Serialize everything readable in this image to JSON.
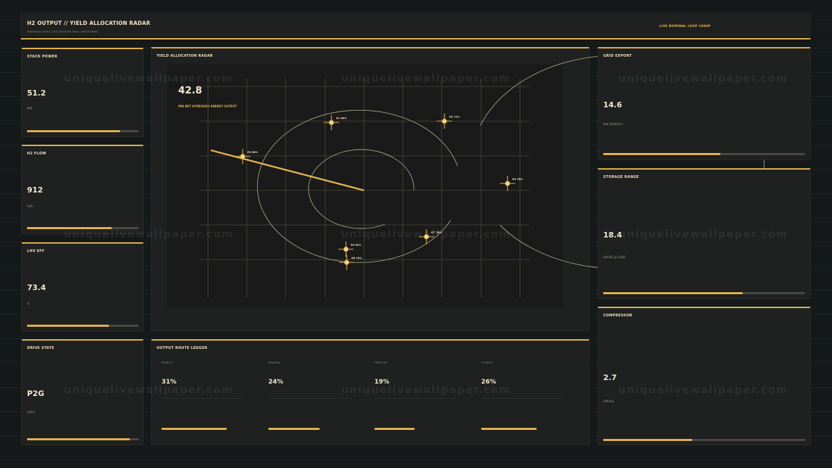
{
  "header": {
    "title": "H2 OUTPUT // YIELD ALLOCATION RADAR",
    "subtitle": "RENEWABLE INPUT / ELECTROLYZER YIELD / PARTITIONING",
    "status": "LIVE  NOMINAL  LOOP 1000P"
  },
  "watermark": "uniquelivewallpaper.com",
  "left_panels": [
    {
      "title": "STACK POWER",
      "value": "51.2",
      "unit": "MW",
      "fill": 0.83
    },
    {
      "title": "H2 FLOW",
      "value": "912",
      "unit": "kg/h",
      "fill": 0.76
    },
    {
      "title": "LHV EFF",
      "value": "73.4",
      "unit": "%",
      "fill": 0.73
    },
    {
      "title": "DRIVE STATE",
      "value": "P2G",
      "unit": "AUTO",
      "fill": 0.92
    }
  ],
  "right_panels": [
    {
      "title": "GRID EXPORT",
      "value": "14.6",
      "unit": "MW DISPATCH",
      "fill": 0.58
    },
    {
      "title": "STORAGE RANGE",
      "value": "18.4",
      "unit": "HOURS @ LOAD",
      "fill": 0.69
    },
    {
      "title": "COMPRESSOR",
      "value": "2.7",
      "unit": "kWh/kg",
      "fill": 0.44
    }
  ],
  "radar": {
    "title": "YIELD ALLOCATION RADAR",
    "value": "42.8",
    "caption": "MW NET HYDROGEN ENERGY OUTPUT",
    "targets": [
      {
        "label": "R1 86%"
      },
      {
        "label": "R2 72%"
      },
      {
        "label": "R3 88%"
      },
      {
        "label": "R4 78%"
      },
      {
        "label": "R7 70%"
      },
      {
        "label": "R5 84%"
      },
      {
        "label": "R6 79%"
      }
    ]
  },
  "ledger": {
    "title": "OUTPUT ROUTE LEDGER",
    "routes": [
      {
        "label": "MOBILITY",
        "pct": "31%",
        "share": 0.31
      },
      {
        "label": "AMMONIA",
        "pct": "24%",
        "share": 0.24
      },
      {
        "label": "GRID FUEL",
        "pct": "19%",
        "share": 0.19
      },
      {
        "label": "STORAGE",
        "pct": "26%",
        "share": 0.26
      }
    ]
  },
  "colors": {
    "accent": "#e3b24e",
    "panel": "#1f2020",
    "background": "#15191a",
    "text": "#f3ead0"
  }
}
